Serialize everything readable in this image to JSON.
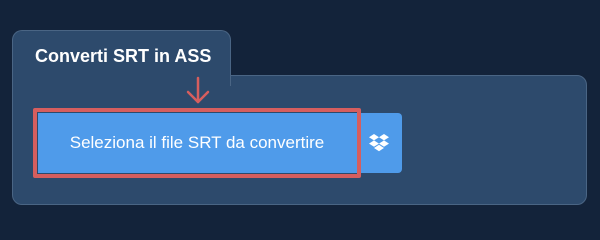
{
  "panel": {
    "title": "Converti SRT in ASS"
  },
  "upload": {
    "select_label": "Seleziona il file SRT da convertire",
    "dropbox_icon": "dropbox-icon"
  },
  "colors": {
    "page_bg": "#13233a",
    "panel_bg": "#2d4a6c",
    "button_bg": "#4f9bea",
    "highlight": "#d65e5e"
  }
}
